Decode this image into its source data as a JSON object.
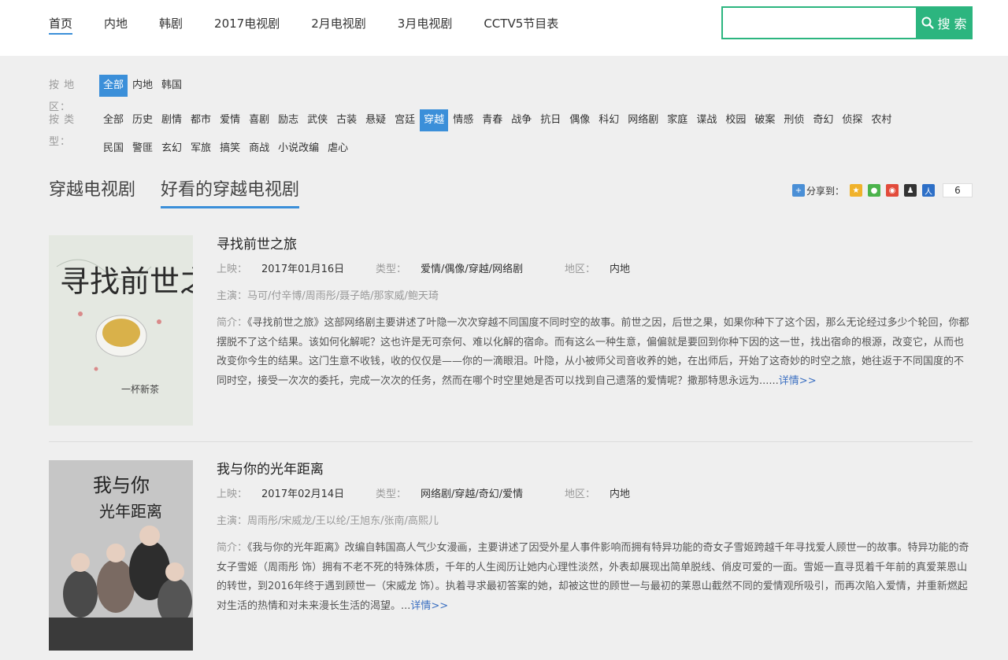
{
  "nav": {
    "items": [
      "首页",
      "内地",
      "韩剧",
      "2017电视剧",
      "2月电视剧",
      "3月电视剧",
      "CCTV5节目表"
    ],
    "active_index": 0
  },
  "search": {
    "value": "",
    "placeholder": "",
    "button_label": "搜 索"
  },
  "filters": {
    "region": {
      "label": "按 地 区：",
      "items": [
        "全部",
        "内地",
        "韩国"
      ],
      "active": "全部"
    },
    "type": {
      "label": "按 类 型：",
      "items": [
        "全部",
        "历史",
        "剧情",
        "都市",
        "爱情",
        "喜剧",
        "励志",
        "武侠",
        "古装",
        "悬疑",
        "宫廷",
        "穿越",
        "情感",
        "青春",
        "战争",
        "抗日",
        "偶像",
        "科幻",
        "网络剧",
        "家庭",
        "谍战",
        "校园",
        "破案",
        "刑侦",
        "奇幻",
        "侦探",
        "农村",
        "民国",
        "警匪",
        "玄幻",
        "军旅",
        "搞笑",
        "商战",
        "小说改编",
        "虐心"
      ],
      "active": "穿越"
    }
  },
  "section": {
    "title1": "穿越电视剧",
    "title2": "好看的穿越电视剧",
    "share_label": "分享到：",
    "share_count": "6",
    "share_icons": [
      "qzone-icon",
      "wechat-icon",
      "weibo-icon",
      "qq-icon",
      "renren-icon"
    ]
  },
  "labels": {
    "release": "上映：",
    "genre": "类型：",
    "region": "地区：",
    "actors": "主演：",
    "summary": "简介：",
    "more": "详情>>"
  },
  "entries": [
    {
      "title": "寻找前世之旅",
      "release": "2017年01月16日",
      "genre": "爱情/偶像/穿越/网络剧",
      "region": "内地",
      "actors": "马可/付辛博/周雨彤/聂子皓/那家威/鲍天琦",
      "summary": "《寻找前世之旅》这部网络剧主要讲述了叶隐一次次穿越不同国度不同时空的故事。前世之因，后世之果，如果你种下了这个因，那么无论经过多少个轮回，你都摆脱不了这个结果。该如何化解呢？这也许是无可奈何、难以化解的宿命。而有这么一种生意，偏偏就是要回到你种下因的这一世，找出宿命的根源，改变它，从而也改变你今生的结果。这门生意不收钱，收的仅仅是——你的一滴眼泪。叶隐，从小被师父司音收养的她，在出师后，开始了这奇妙的时空之旅，她往返于不同国度的不同时空，接受一次次的委托，完成一次次的任务，然而在哪个时空里她是否可以找到自己遗落的爱情呢？撒那特思永远为......"
    },
    {
      "title": "我与你的光年距离",
      "release": "2017年02月14日",
      "genre": "网络剧/穿越/奇幻/爱情",
      "region": "内地",
      "actors": "周雨彤/宋威龙/王以纶/王旭东/张南/高熙儿",
      "summary": "《我与你的光年距离》改编自韩国高人气少女漫画，主要讲述了因受外星人事件影响而拥有特异功能的奇女子雪姬跨越千年寻找爱人顾世一的故事。特异功能的奇女子雪姬（周雨彤 饰）拥有不老不死的特殊体质，千年的人生阅历让她内心理性淡然，外表却展现出简单脱线、俏皮可爱的一面。雪姬一直寻觅着千年前的真爱莱恩山的转世，到2016年终于遇到顾世一（宋威龙 饰）。执着寻求最初答案的她，却被这世的顾世一与最初的莱恩山截然不同的爱情观所吸引，而再次陷入爱情，并重新燃起对生活的热情和对未来漫长生活的渴望。..."
    }
  ],
  "colors": {
    "accent": "#3b8fd9",
    "search_green": "#2cb57f",
    "link": "#3b6fc1"
  }
}
